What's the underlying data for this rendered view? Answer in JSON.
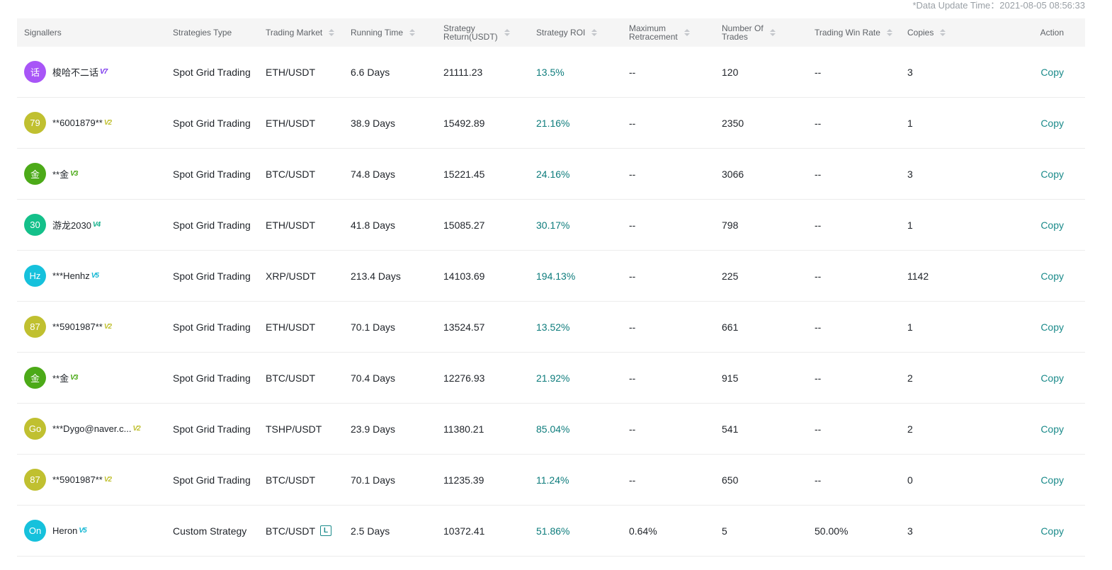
{
  "update_time": "*Data Update Time：2021-08-05 08:56:33",
  "colors": {
    "accent": "#1a8a8a",
    "roi": "#0d7c7c",
    "header_bg": "#f5f5f5"
  },
  "columns": [
    {
      "key": "signaller",
      "label": "Signallers",
      "sortable": false
    },
    {
      "key": "type",
      "label": "Strategies Type",
      "sortable": false
    },
    {
      "key": "market",
      "label": "Trading Market",
      "sortable": true
    },
    {
      "key": "running",
      "label": "Running Time",
      "sortable": true
    },
    {
      "key": "return",
      "label": "Strategy Return(USDT)",
      "sortable": true
    },
    {
      "key": "roi",
      "label": "Strategy ROI",
      "sortable": true
    },
    {
      "key": "retracement",
      "label": "Maximum Retracement",
      "sortable": true
    },
    {
      "key": "trades",
      "label": "Number Of Trades",
      "sortable": true
    },
    {
      "key": "win_rate",
      "label": "Trading Win Rate",
      "sortable": true
    },
    {
      "key": "copies",
      "label": "Copies",
      "sortable": true
    },
    {
      "key": "action",
      "label": "Action",
      "sortable": false
    }
  ],
  "header_lines": {
    "signaller": [
      "Signallers"
    ],
    "type": [
      "Strategies Type"
    ],
    "market": [
      "Trading Market"
    ],
    "running": [
      "Running Time"
    ],
    "return": [
      "Strategy",
      "Return(USDT)"
    ],
    "roi": [
      "Strategy ROI"
    ],
    "retracement": [
      "Maximum",
      "Retracement"
    ],
    "trades": [
      "Number Of",
      "Trades"
    ],
    "win_rate": [
      "Trading Win Rate"
    ],
    "copies": [
      "Copies"
    ],
    "action": [
      "Action"
    ]
  },
  "rows": [
    {
      "avatar": "话",
      "avatar_color": "#a855f7",
      "name": "梭哈不二话",
      "level": "V7",
      "level_color": "#7c3aed",
      "type": "Spot Grid Trading",
      "market": "ETH/USDT",
      "leverage": "",
      "running": "6.6 Days",
      "return": "21111.23",
      "roi": "13.5%",
      "retracement": "--",
      "trades": "120",
      "win_rate": "--",
      "copies": "3",
      "action": "Copy"
    },
    {
      "avatar": "79",
      "avatar_color": "#c0c030",
      "name": "**6001879**",
      "level": "V2",
      "level_color": "#c0c030",
      "type": "Spot Grid Trading",
      "market": "ETH/USDT",
      "leverage": "",
      "running": "38.9 Days",
      "return": "15492.89",
      "roi": "21.16%",
      "retracement": "--",
      "trades": "2350",
      "win_rate": "--",
      "copies": "1",
      "action": "Copy"
    },
    {
      "avatar": "金",
      "avatar_color": "#4caa18",
      "name": "**金",
      "level": "V3",
      "level_color": "#4caa18",
      "type": "Spot Grid Trading",
      "market": "BTC/USDT",
      "leverage": "",
      "running": "74.8 Days",
      "return": "15221.45",
      "roi": "24.16%",
      "retracement": "--",
      "trades": "3066",
      "win_rate": "--",
      "copies": "3",
      "action": "Copy"
    },
    {
      "avatar": "30",
      "avatar_color": "#14c08a",
      "name": "游龙2030",
      "level": "V4",
      "level_color": "#14b08a",
      "type": "Spot Grid Trading",
      "market": "ETH/USDT",
      "leverage": "",
      "running": "41.8 Days",
      "return": "15085.27",
      "roi": "30.17%",
      "retracement": "--",
      "trades": "798",
      "win_rate": "--",
      "copies": "1",
      "action": "Copy"
    },
    {
      "avatar": "Hz",
      "avatar_color": "#16c1dc",
      "name": "***Henhz",
      "level": "V5",
      "level_color": "#16b8d4",
      "type": "Spot Grid Trading",
      "market": "XRP/USDT",
      "leverage": "",
      "running": "213.4 Days",
      "return": "14103.69",
      "roi": "194.13%",
      "retracement": "--",
      "trades": "225",
      "win_rate": "--",
      "copies": "1142",
      "action": "Copy"
    },
    {
      "avatar": "87",
      "avatar_color": "#c0c030",
      "name": "**5901987**",
      "level": "V2",
      "level_color": "#c0c030",
      "type": "Spot Grid Trading",
      "market": "ETH/USDT",
      "leverage": "",
      "running": "70.1 Days",
      "return": "13524.57",
      "roi": "13.52%",
      "retracement": "--",
      "trades": "661",
      "win_rate": "--",
      "copies": "1",
      "action": "Copy"
    },
    {
      "avatar": "金",
      "avatar_color": "#4caa18",
      "name": "**金",
      "level": "V3",
      "level_color": "#4caa18",
      "type": "Spot Grid Trading",
      "market": "BTC/USDT",
      "leverage": "",
      "running": "70.4 Days",
      "return": "12276.93",
      "roi": "21.92%",
      "retracement": "--",
      "trades": "915",
      "win_rate": "--",
      "copies": "2",
      "action": "Copy"
    },
    {
      "avatar": "Go",
      "avatar_color": "#c0c030",
      "name": "***Dygo@naver.c...",
      "level": "V2",
      "level_color": "#c0c030",
      "type": "Spot Grid Trading",
      "market": "TSHP/USDT",
      "leverage": "",
      "running": "23.9 Days",
      "return": "11380.21",
      "roi": "85.04%",
      "retracement": "--",
      "trades": "541",
      "win_rate": "--",
      "copies": "2",
      "action": "Copy"
    },
    {
      "avatar": "87",
      "avatar_color": "#c0c030",
      "name": "**5901987**",
      "level": "V2",
      "level_color": "#c0c030",
      "type": "Spot Grid Trading",
      "market": "BTC/USDT",
      "leverage": "",
      "running": "70.1 Days",
      "return": "11235.39",
      "roi": "11.24%",
      "retracement": "--",
      "trades": "650",
      "win_rate": "--",
      "copies": "0",
      "action": "Copy"
    },
    {
      "avatar": "On",
      "avatar_color": "#16c1dc",
      "name": "Heron",
      "level": "V5",
      "level_color": "#16b8d4",
      "type": "Custom Strategy",
      "market": "BTC/USDT",
      "leverage": "L",
      "running": "2.5 Days",
      "return": "10372.41",
      "roi": "51.86%",
      "retracement": "0.64%",
      "trades": "5",
      "win_rate": "50.00%",
      "copies": "3",
      "action": "Copy"
    }
  ]
}
